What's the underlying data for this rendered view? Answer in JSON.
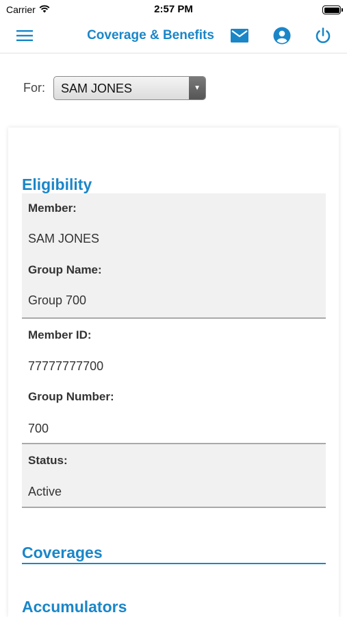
{
  "status_bar": {
    "carrier": "Carrier",
    "time": "2:57 PM"
  },
  "nav": {
    "title": "Coverage & Benefits"
  },
  "selector": {
    "label": "For:",
    "value": "SAM JONES"
  },
  "sections": {
    "eligibility": "Eligibility",
    "coverages": "Coverages",
    "accumulators": "Accumulators"
  },
  "eligibility": {
    "member_label": "Member:",
    "member_value": "SAM JONES",
    "group_name_label": "Group Name:",
    "group_name_value": "Group 700",
    "member_id_label": "Member ID:",
    "member_id_value": "77777777700",
    "group_number_label": "Group Number:",
    "group_number_value": "700",
    "status_label": "Status:",
    "status_value": "Active"
  },
  "colors": {
    "accent": "#1a86c8",
    "shaded_row": "#f1f1f1",
    "divider": "#a9a9a9"
  },
  "icons": [
    "wifi-icon",
    "battery-icon",
    "menu-icon",
    "mail-icon",
    "account-icon",
    "power-icon",
    "dropdown-arrow-icon"
  ]
}
